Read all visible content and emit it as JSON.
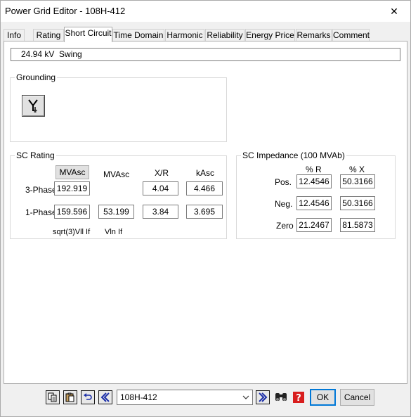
{
  "window": {
    "title": "Power Grid Editor - 108H-412",
    "close_glyph": "✕"
  },
  "tabs": [
    {
      "label": "Info"
    },
    {
      "label": "Rating"
    },
    {
      "label": "Short Circuit"
    },
    {
      "label": "Time Domain"
    },
    {
      "label": "Harmonic"
    },
    {
      "label": "Reliability"
    },
    {
      "label": "Energy Price"
    },
    {
      "label": "Remarks"
    },
    {
      "label": "Comment"
    }
  ],
  "active_tab": "Short Circuit",
  "status": {
    "text": "24.94 kV  Swing"
  },
  "grounding": {
    "label": "Grounding",
    "button_icon": "grounding-wye-icon"
  },
  "sc_rating": {
    "label": "SC Rating",
    "col_mvasc_button": "MVAsc",
    "col_mvasc": "MVAsc",
    "col_xr": "X/R",
    "col_kasc": "kAsc",
    "three_phase": {
      "label": "3-Phase",
      "mvasc_a": "192.919",
      "mvasc_b": "",
      "xr": "4.04",
      "kasc": "4.466"
    },
    "one_phase": {
      "label": "1-Phase",
      "mvasc_a": "159.596",
      "mvasc_b": "53.199",
      "xr": "3.84",
      "kasc": "3.695"
    },
    "foot_a": "sqrt(3)Vll If",
    "foot_b": "Vln If"
  },
  "sc_impedance": {
    "label": "SC Impedance (100 MVAb)",
    "col_r": "% R",
    "col_x": "% X",
    "pos": {
      "label": "Pos.",
      "r": "12.4546",
      "x": "50.3166"
    },
    "neg": {
      "label": "Neg.",
      "r": "12.4546",
      "x": "50.3166"
    },
    "zero": {
      "label": "Zero",
      "r": "21.2467",
      "x": "81.5873"
    }
  },
  "toolbar": {
    "icons": [
      "copy-icon",
      "paste-icon",
      "undo-icon",
      "previous-icon",
      "next-icon",
      "find-icon",
      "help-icon"
    ],
    "combo_value": "108H-412",
    "ok": "OK",
    "cancel": "Cancel"
  }
}
